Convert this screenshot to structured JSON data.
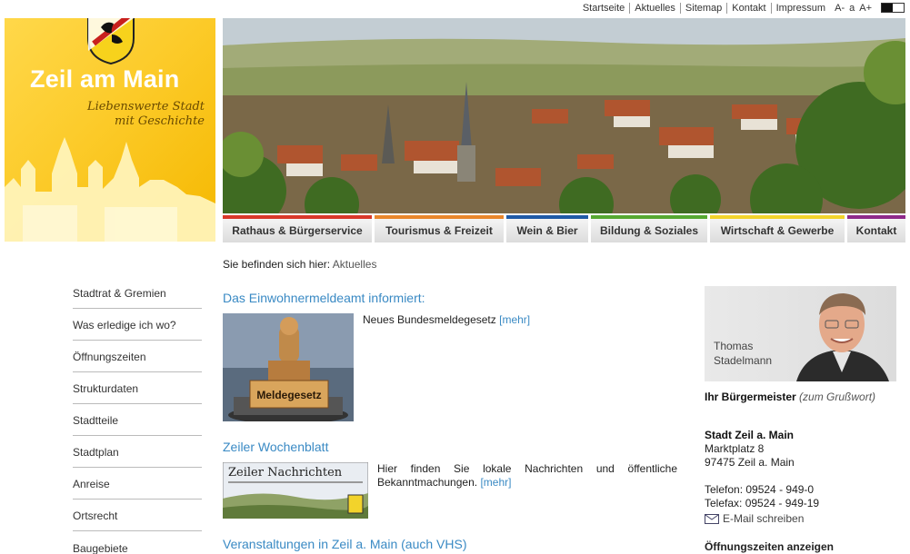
{
  "toplinks": [
    "Startseite",
    "Aktuelles",
    "Sitemap",
    "Kontakt",
    "Impressum"
  ],
  "fontsize": [
    "A-",
    "a",
    "A+"
  ],
  "brand": {
    "title": "Zeil am Main",
    "tagline_1": "Liebenswerte Stadt",
    "tagline_2": "mit Geschichte"
  },
  "mainnav": [
    {
      "label": "Rathaus & Bürgerservice",
      "color": "#d9382a",
      "width": 164
    },
    {
      "label": "Tourismus & Freizeit",
      "color": "#e8862c",
      "width": 142
    },
    {
      "label": "Wein & Bier",
      "color": "#1f5aa6",
      "width": 90
    },
    {
      "label": "Bildung & Soziales",
      "color": "#56a832",
      "width": 128
    },
    {
      "label": "Wirtschaft & Gewerbe",
      "color": "#f2d32b",
      "width": 148
    },
    {
      "label": "Kontakt",
      "color": "#8e2a8a",
      "width": 64
    }
  ],
  "subnav": [
    "Stadtrat & Gremien",
    "Was erledige ich wo?",
    "Öffnungszeiten",
    "Strukturdaten",
    "Stadtteile",
    "Stadtplan",
    "Anreise",
    "Ortsrecht",
    "Baugebiete"
  ],
  "breadcrumb": {
    "label": "Sie befinden sich hier:",
    "current": "Aktuelles"
  },
  "news": [
    {
      "title": "Das Einwohnermeldeamt informiert:",
      "text": "Neues Bundesmeldegesetz",
      "more": "[mehr]",
      "image_label": "Meldegesetz"
    },
    {
      "title": "Zeiler Wochenblatt",
      "text": "Hier finden Sie lokale Nachrichten und öffentliche Bekanntmachungen.",
      "more": "[mehr]",
      "image_label": "Zeiler Nachrichten"
    },
    {
      "title": "Veranstaltungen in Zeil a. Main (auch VHS)"
    }
  ],
  "mayor": {
    "first": "Thomas",
    "last": "Stadelmann",
    "role": "Ihr Bürgermeister",
    "link": "(zum Grußwort)"
  },
  "address": {
    "name": "Stadt Zeil a.  Main",
    "street": "Marktplatz 8",
    "city": "97475 Zeil a. Main"
  },
  "contact": {
    "phone": "Telefon:  09524 - 949-0",
    "fax": "Telefax:  09524 - 949-19",
    "mail": "E-Mail schreiben"
  },
  "openings": "Öffnungszeiten anzeigen"
}
